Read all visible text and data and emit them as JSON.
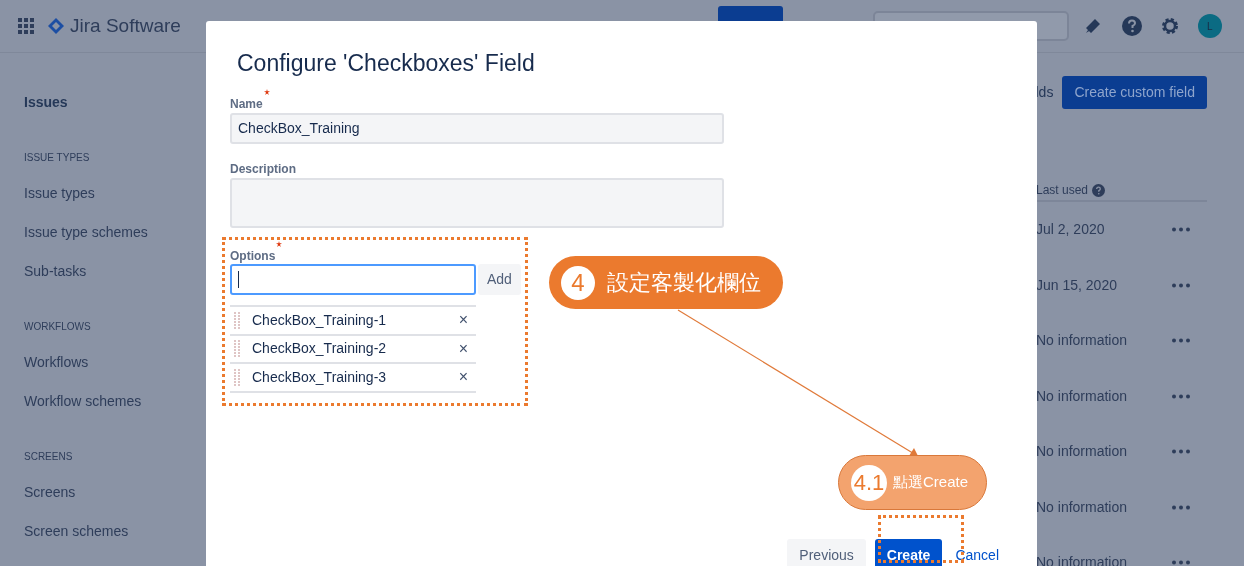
{
  "top_bar": {
    "product": "Jira Software",
    "avatar_initial": "L"
  },
  "sidebar": {
    "title": "Issues",
    "sections": [
      {
        "heading": "ISSUE TYPES",
        "items": [
          {
            "label": "Issue types"
          },
          {
            "label": "Issue type schemes"
          },
          {
            "label": "Sub-tasks"
          }
        ]
      },
      {
        "heading": "WORKFLOWS",
        "items": [
          {
            "label": "Workflows"
          },
          {
            "label": "Workflow schemes"
          }
        ]
      },
      {
        "heading": "SCREENS",
        "items": [
          {
            "label": "Screens"
          },
          {
            "label": "Screen schemes"
          }
        ]
      }
    ]
  },
  "page_header": {
    "link_partial": "lds",
    "button": "Create custom field"
  },
  "table": {
    "columns": [
      {
        "label": "Last used"
      }
    ],
    "rows": [
      {
        "last_used": "Jul 2, 2020"
      },
      {
        "last_used": "Jun 15, 2020"
      },
      {
        "last_used": "No information"
      },
      {
        "last_used": "No information"
      },
      {
        "last_used": "No information"
      },
      {
        "last_used": "No information"
      },
      {
        "last_used": "No information"
      }
    ]
  },
  "dialog": {
    "title": "Configure 'Checkboxes' Field",
    "name_field": {
      "label": "Name",
      "required": true,
      "value": "CheckBox_Training"
    },
    "description_field": {
      "label": "Description"
    },
    "options_field": {
      "label": "Options",
      "required": true,
      "focused": true,
      "add_button": "Add",
      "items": [
        {
          "label": "CheckBox_Training-1",
          "remove": "×"
        },
        {
          "label": "CheckBox_Training-2",
          "remove": "×"
        },
        {
          "label": "CheckBox_Training-3",
          "remove": "×"
        }
      ]
    },
    "buttons": [
      {
        "label": "Previous",
        "kind": "secondary"
      },
      {
        "label": "Create",
        "kind": "primary"
      },
      {
        "label": "Cancel",
        "kind": "link"
      }
    ]
  },
  "annotations": [
    {
      "number": "4",
      "text": "設定客製化欄位",
      "kind": "strong"
    },
    {
      "number": "4.1",
      "text": "點選Create",
      "kind": "light"
    }
  ]
}
